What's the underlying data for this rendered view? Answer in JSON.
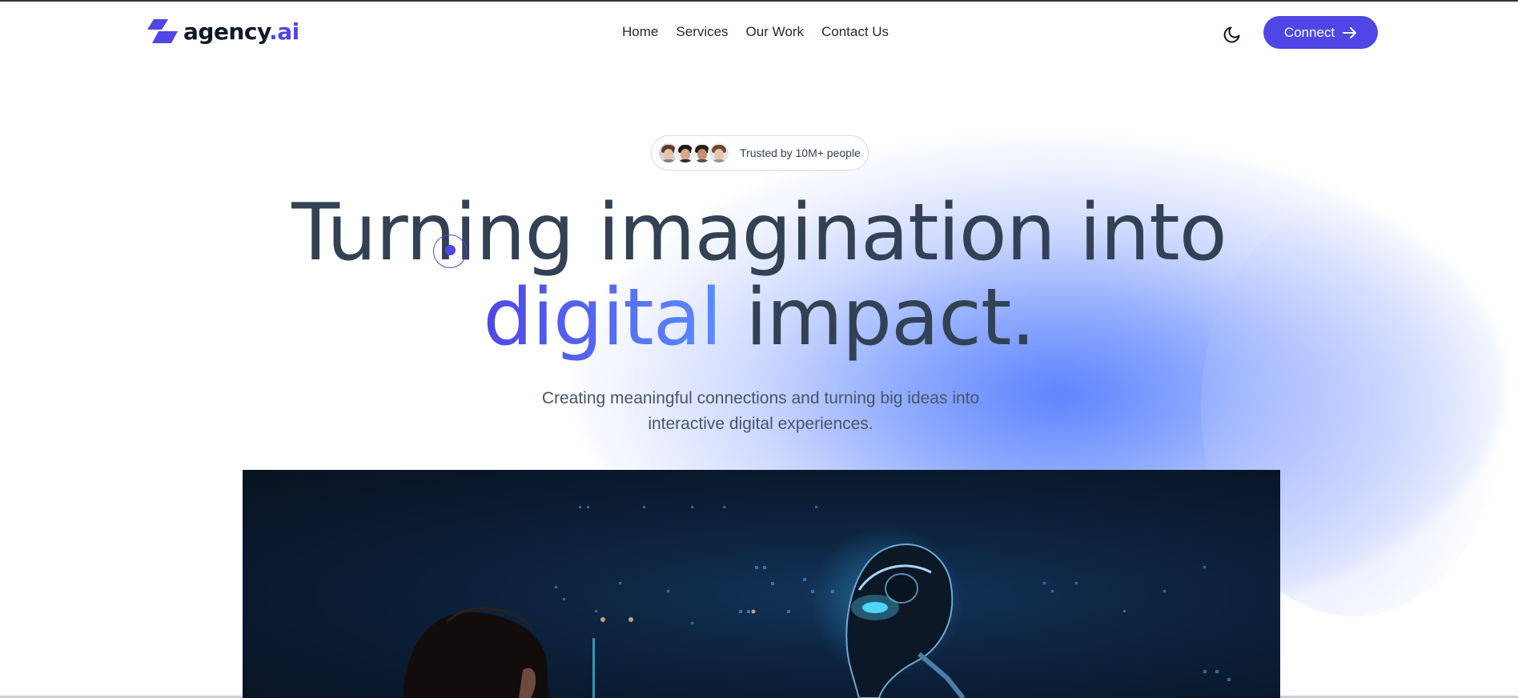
{
  "brand": {
    "name_main": "agency",
    "name_suffix": ".ai",
    "accent_color": "#4f46e5"
  },
  "nav": {
    "items": [
      {
        "label": "Home"
      },
      {
        "label": "Services"
      },
      {
        "label": "Our Work"
      },
      {
        "label": "Contact Us"
      }
    ]
  },
  "header": {
    "theme_toggle_icon": "moon-icon",
    "connect_label": "Connect",
    "connect_icon": "arrow-right-icon"
  },
  "hero": {
    "badge_text": "Trusted by 10M+ people",
    "avatar_count": 4,
    "headline_line1": "Turning imagination into",
    "headline_accent": "digital",
    "headline_rest": "impact.",
    "subtitle_line1": "Creating meaningful connections and turning big ideas into",
    "subtitle_line2": "interactive digital experiences.",
    "image_icon": "human-and-robot-illustration"
  }
}
